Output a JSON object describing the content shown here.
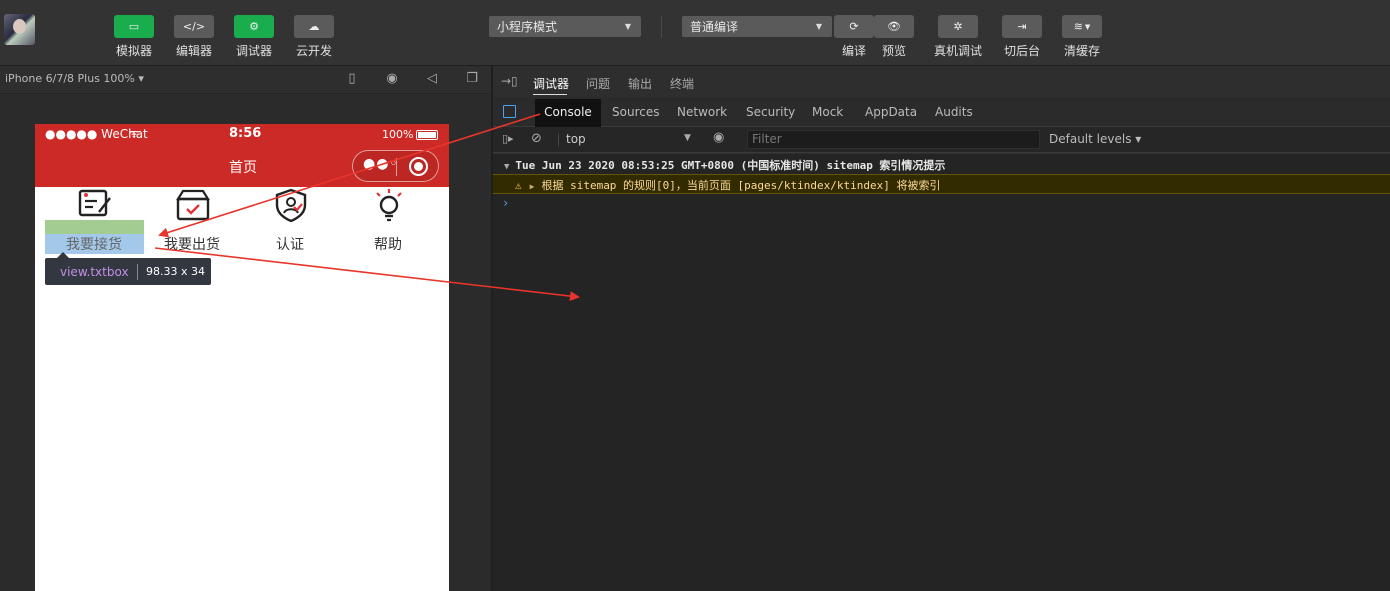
{
  "toolbar": {
    "buttons": [
      {
        "label": "模拟器",
        "icon": "phone-icon",
        "glyph": "▭"
      },
      {
        "label": "编辑器",
        "icon": "code-icon",
        "glyph": "</>"
      },
      {
        "label": "调试器",
        "icon": "debug-icon",
        "glyph": "⚙"
      },
      {
        "label": "云开发",
        "icon": "cloud-icon",
        "glyph": "☁"
      }
    ],
    "mode_select": "小程序模式",
    "compile_select": "普通编译",
    "actions": [
      {
        "label": "编译",
        "icon": "refresh-icon",
        "glyph": "⟳"
      },
      {
        "label": "预览",
        "icon": "eye-icon",
        "glyph": "👁"
      },
      {
        "label": "真机调试",
        "icon": "bug-icon",
        "glyph": "✲"
      },
      {
        "label": "切后台",
        "icon": "switch-icon",
        "glyph": "⇥"
      },
      {
        "label": "清缓存",
        "icon": "layers-icon",
        "glyph": "≋"
      }
    ]
  },
  "simulator": {
    "device": "iPhone 6/7/8 Plus 100% ▾",
    "status": {
      "carrier": "●●●●● WeChat",
      "time": "8:56",
      "battery": "100%"
    },
    "nav_title": "首页",
    "menu": [
      {
        "label": "我要接货",
        "icon": "form-icon"
      },
      {
        "label": "我要出货",
        "icon": "box-icon"
      },
      {
        "label": "认证",
        "icon": "shield-icon"
      },
      {
        "label": "帮助",
        "icon": "bulb-icon"
      }
    ],
    "tooltip": {
      "selector": "view.txtbox",
      "size": "98.33 x 34"
    }
  },
  "debugger": {
    "tabs": [
      "调试器",
      "问题",
      "输出",
      "终端"
    ],
    "active_tab": "调试器",
    "devtools_tabs": [
      "Console",
      "Sources",
      "Network",
      "Security",
      "Mock",
      "AppData",
      "Audits"
    ],
    "active_devtools_tab": "Console",
    "context": "top",
    "filter_placeholder": "Filter",
    "levels": "Default levels ▾"
  },
  "console": {
    "group_header": "Tue Jun 23 2020 08:53:25 GMT+0800 (中国标准时间) sitemap 索引情况提示",
    "warning": "根据 sitemap 的规则[0]，当前页面 [pages/ktindex/ktindex] 将被索引",
    "prompt": "›"
  },
  "colors": {
    "accent": "#1aad4e",
    "nav_red": "#cc2a27",
    "warning_bg": "#332b00",
    "arrow": "#e8352b"
  }
}
